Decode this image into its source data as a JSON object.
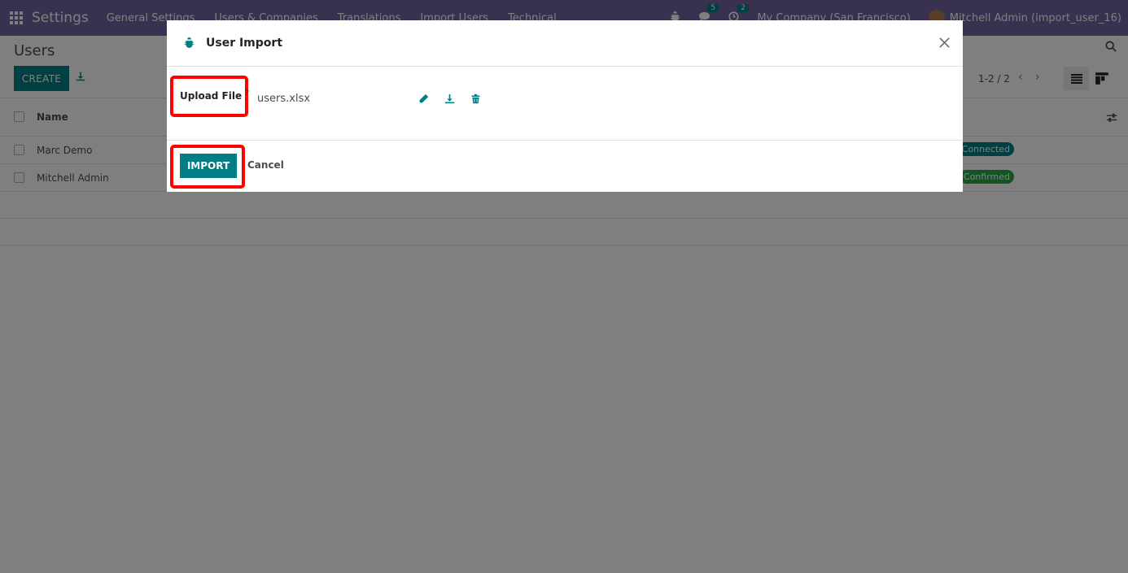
{
  "navbar": {
    "brand": "Settings",
    "menu": [
      "General Settings",
      "Users & Companies",
      "Translations",
      "Import Users",
      "Technical"
    ],
    "messages_count": "5",
    "activities_count": "2",
    "company": "My Company (San Francisco)",
    "user": "Mitchell Admin (import_user_16)"
  },
  "control": {
    "title": "Users",
    "create_label": "CREATE",
    "pager": "1-2 / 2"
  },
  "list": {
    "column_name": "Name",
    "rows": [
      {
        "name": "Marc Demo",
        "status": "Connected",
        "status_color": "#017e84"
      },
      {
        "name": "Mitchell Admin",
        "status": "Confirmed",
        "status_color": "#28a745"
      }
    ]
  },
  "modal": {
    "title": "User Import",
    "upload_label": "Upload File",
    "help_mark": "?",
    "file_name": "users.xlsx",
    "import_label": "IMPORT",
    "cancel_label": "Cancel",
    "highlight_color": "#ff0000"
  },
  "colors": {
    "navbar": "#71639e",
    "primary": "#017e84"
  }
}
